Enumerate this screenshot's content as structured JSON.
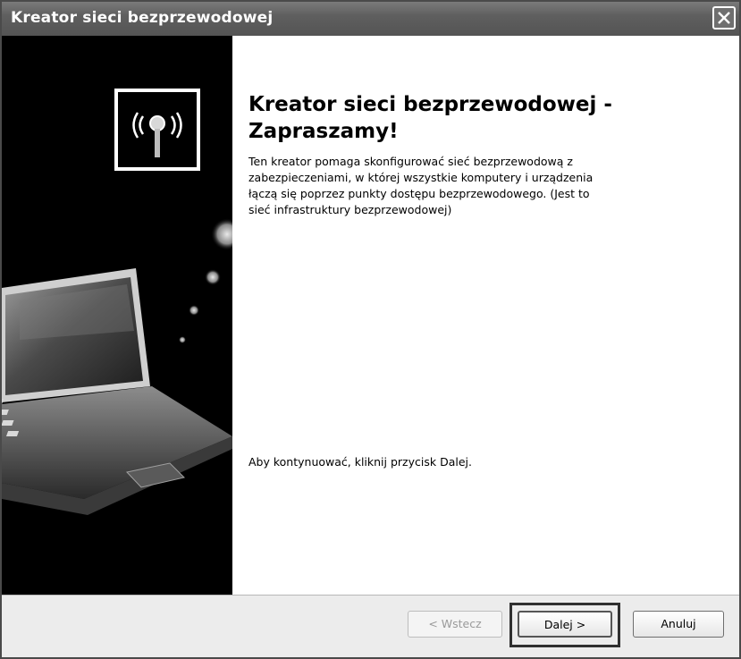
{
  "window": {
    "title": "Kreator sieci bezprzewodowej",
    "close_icon": "close-icon"
  },
  "main": {
    "heading_line1": "Kreator sieci bezprzewodowej -",
    "heading_line2": "Zapraszamy!",
    "description_lines": [
      "Ten kreator pomaga skonfigurować sieć bezprzewodową z",
      "zabezpieczeniami, w której wszystkie komputery i urządzenia",
      "łączą się poprzez punkty dostępu bezprzewodowego. (Jest to",
      "sieć infrastruktury bezprzewodowej)"
    ],
    "continue_text": "Aby kontynuować, kliknij przycisk Dalej."
  },
  "side_panel": {
    "illustration": "laptop-wireless-illustration",
    "badge_icon": "wireless-antenna-icon"
  },
  "footer": {
    "back_label": "< Wstecz",
    "next_label": "Dalej >",
    "cancel_label": "Anuluj",
    "back_enabled": false,
    "focused_button": "next"
  }
}
